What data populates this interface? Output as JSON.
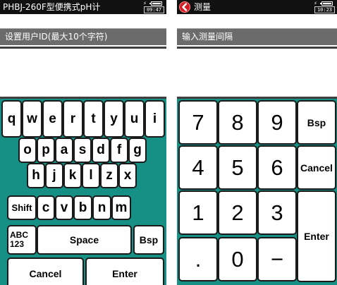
{
  "left_screen": {
    "title": "PHBJ-260F型便携式pH计",
    "clock": "09:47",
    "prompt": "设置用户ID(最大10个字符)",
    "input_value": "",
    "keyboard": {
      "row1": [
        "q",
        "w",
        "e",
        "r",
        "t",
        "y",
        "u",
        "i"
      ],
      "row2": [
        "o",
        "p",
        "a",
        "s",
        "d",
        "f",
        "g"
      ],
      "row3": [
        "h",
        "j",
        "k",
        "l",
        "z",
        "x"
      ],
      "row4": [
        "Shift",
        "c",
        "v",
        "b",
        "n",
        "m"
      ],
      "row5": {
        "abc_line1": "ABC",
        "abc_line2": "123",
        "space": "Space",
        "bsp": "Bsp"
      },
      "row6": {
        "cancel": "Cancel",
        "enter": "Enter"
      }
    }
  },
  "right_screen": {
    "title": "测量",
    "clock": "10:23",
    "prompt": "输入测量间隔",
    "input_value": "",
    "keypad": {
      "digits": [
        "7",
        "8",
        "9",
        "4",
        "5",
        "6",
        "1",
        "2",
        "3",
        ".",
        "0",
        "−"
      ],
      "bsp": "Bsp",
      "cancel": "Cancel",
      "enter": "Enter"
    }
  },
  "colors": {
    "keyboard_bg": "#168f84",
    "label_bar": "#6b6b6b",
    "titlebar": "#111111",
    "back_button": "#d21d24"
  }
}
